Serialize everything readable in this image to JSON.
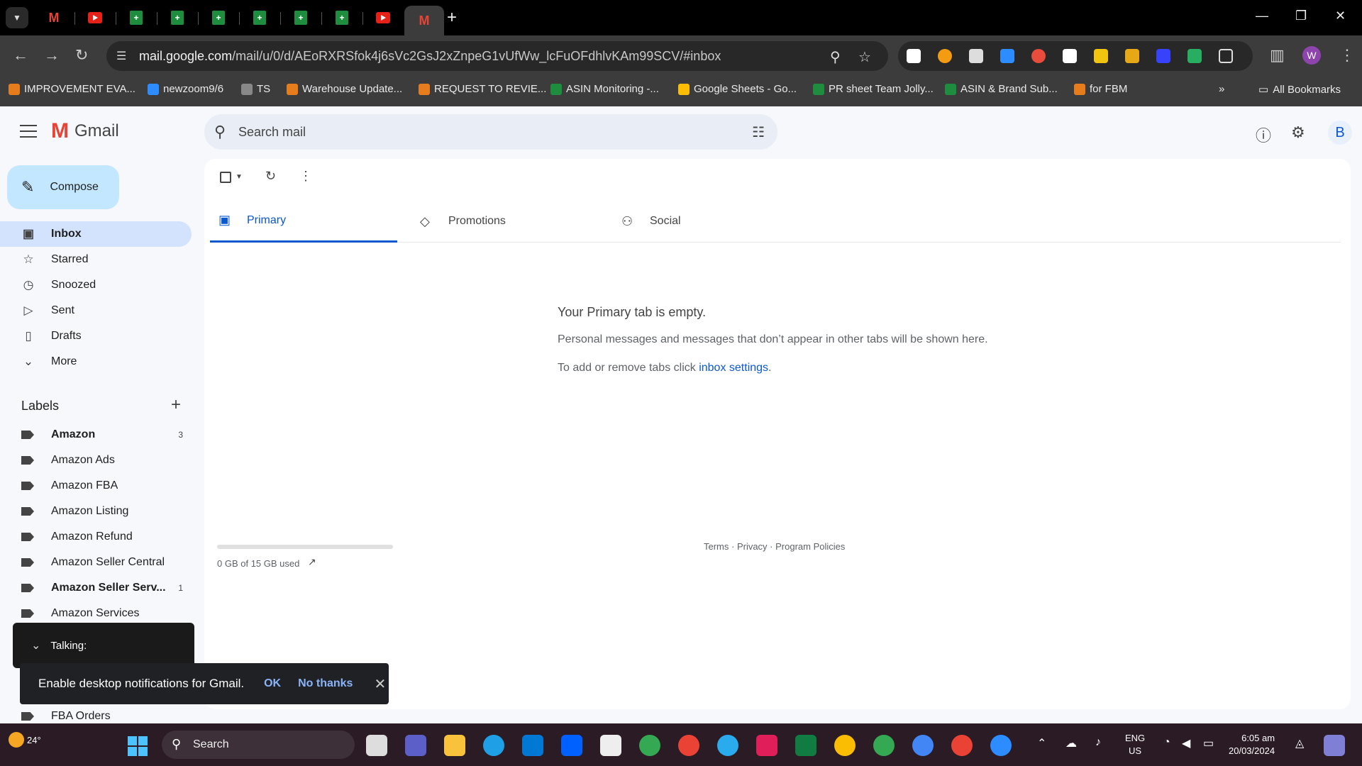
{
  "browser": {
    "tabs": [
      {
        "kind": "gmail",
        "icon": "gmail-icon"
      },
      {
        "kind": "youtube",
        "icon": "youtube-icon"
      },
      {
        "kind": "sheet",
        "icon": "sheets-icon"
      },
      {
        "kind": "sheet",
        "icon": "sheets-icon"
      },
      {
        "kind": "sheet",
        "icon": "sheets-icon"
      },
      {
        "kind": "sheet",
        "icon": "sheets-icon"
      },
      {
        "kind": "sheet",
        "icon": "sheets-icon"
      },
      {
        "kind": "sheet",
        "icon": "sheets-icon"
      },
      {
        "kind": "youtube",
        "icon": "youtube-icon"
      },
      {
        "kind": "gmail",
        "icon": "gmail-icon",
        "active": true
      }
    ],
    "url_host": "mail.google.com",
    "url_path": "/mail/u/0/d/AEoRXRSfok4j6sVc2GsJ2xZnpeG1vUfWw_lcFuOFdhlvKAm99SCV/#inbox",
    "profile_initial": "W",
    "bookmarks": [
      {
        "label": "IMPROVEMENT EVA...",
        "color": "#e67c1b"
      },
      {
        "label": "newzoom9/6",
        "color": "#2d8cff"
      },
      {
        "label": "TS",
        "color": "#888888"
      },
      {
        "label": "Warehouse Update...",
        "color": "#e67c1b"
      },
      {
        "label": "REQUEST TO REVIE...",
        "color": "#e67c1b"
      },
      {
        "label": "ASIN Monitoring -...",
        "color": "#1e8e3e"
      },
      {
        "label": "Google Sheets - Go...",
        "color": "#fbbc04"
      },
      {
        "label": "PR sheet Team Jolly...",
        "color": "#1e8e3e"
      },
      {
        "label": "ASIN & Brand Sub...",
        "color": "#1e8e3e"
      },
      {
        "label": "for FBM",
        "color": "#e67c1b"
      }
    ],
    "all_bookmarks": "All Bookmarks"
  },
  "gmail": {
    "app_name": "Gmail",
    "search_placeholder": "Search mail",
    "account_initial": "B",
    "compose": "Compose",
    "nav": [
      {
        "label": "Inbox",
        "icon": "inbox-icon",
        "glyph": "▣",
        "active": true
      },
      {
        "label": "Starred",
        "icon": "star-icon",
        "glyph": "☆"
      },
      {
        "label": "Snoozed",
        "icon": "clock-icon",
        "glyph": "◷"
      },
      {
        "label": "Sent",
        "icon": "send-icon",
        "glyph": "▷"
      },
      {
        "label": "Drafts",
        "icon": "draft-icon",
        "glyph": "▯"
      },
      {
        "label": "More",
        "icon": "chevron-down-icon",
        "glyph": "⌄"
      }
    ],
    "labels_title": "Labels",
    "labels": [
      {
        "name": "Amazon",
        "count": "3",
        "bold": true
      },
      {
        "name": "Amazon Ads",
        "count": ""
      },
      {
        "name": "Amazon FBA",
        "count": ""
      },
      {
        "name": "Amazon Listing",
        "count": ""
      },
      {
        "name": "Amazon Refund",
        "count": ""
      },
      {
        "name": "Amazon Seller Central",
        "count": ""
      },
      {
        "name": "Amazon Seller Serv...",
        "count": "1",
        "bold": true
      },
      {
        "name": "Amazon Services",
        "count": ""
      }
    ],
    "fba_orders": "FBA Orders",
    "tabs": [
      {
        "label": "Primary",
        "icon": "inbox-icon",
        "glyph": "▣",
        "active": true
      },
      {
        "label": "Promotions",
        "icon": "tag-icon",
        "glyph": "◇"
      },
      {
        "label": "Social",
        "icon": "people-icon",
        "glyph": "⚇"
      }
    ],
    "empty_title": "Your Primary tab is empty.",
    "empty_line1": "Personal messages and messages that don’t appear in other tabs will be shown here.",
    "empty_line2_prefix": "To add or remove tabs click ",
    "empty_line2_link": "inbox settings",
    "empty_line2_suffix": ".",
    "storage_text": "0 GB of 15 GB used",
    "storage_used_fraction": 0,
    "footer": "Terms · Privacy · Program Policies",
    "talking": "Talking:",
    "snackbar": {
      "text": "Enable desktop notifications for Gmail.",
      "ok": "OK",
      "no": "No thanks"
    }
  },
  "taskbar": {
    "weather": "24°",
    "search": "Search",
    "lang_top": "ENG",
    "lang_bottom": "US",
    "time": "6:05 am",
    "date": "20/03/2024"
  }
}
